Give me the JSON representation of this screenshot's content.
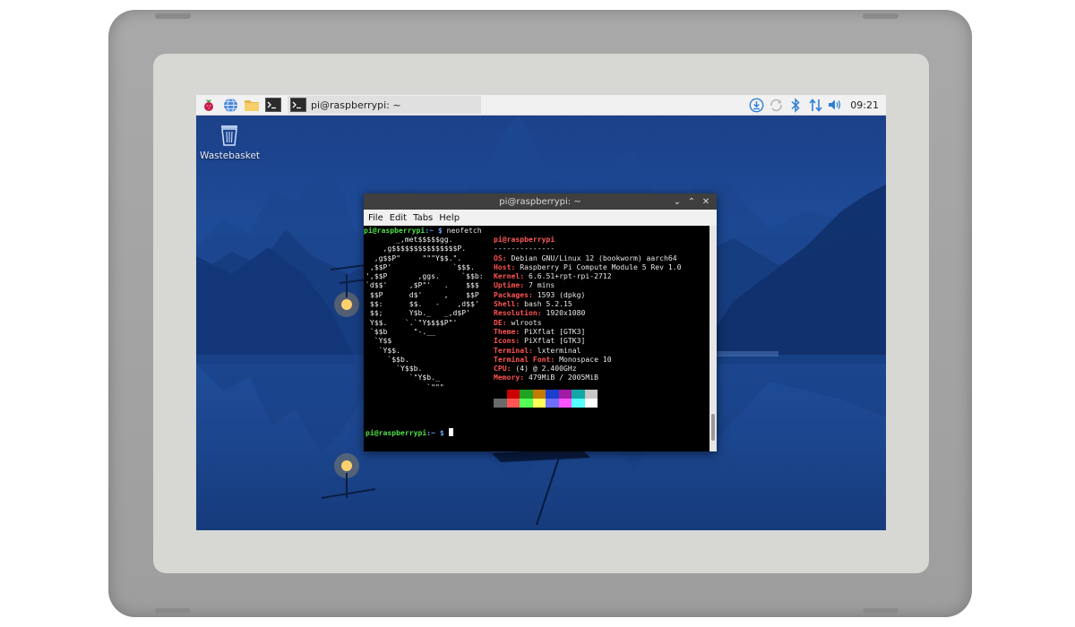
{
  "taskbar": {
    "task_label": "pi@raspberrypi: ~",
    "clock": "09:21",
    "icons": [
      "raspberry-menu-icon",
      "browser-globe-icon",
      "file-manager-icon",
      "terminal-icon"
    ],
    "tray_icons": [
      "updater-icon",
      "sync-icon",
      "bluetooth-icon",
      "network-icon",
      "volume-icon"
    ]
  },
  "desktop": {
    "wastebasket_label": "Wastebasket"
  },
  "terminal": {
    "title": "pi@raspberrypi: ~",
    "controls": [
      "⌄",
      "⌃",
      "✕"
    ],
    "menu": [
      "File",
      "Edit",
      "Tabs",
      "Help"
    ],
    "prompt_user": "pi@raspberrypi",
    "prompt_path": ":~ $",
    "command": " neofetch",
    "logo_lines": [
      "       _,met$$$$$gg.",
      "    ,g$$$$$$$$$$$$$$$P.",
      "  ,g$$P\"     \"\"\"Y$$.\".",
      " ,$$P'              `$$$.",
      "',$$P       ,ggs.     `$$b:",
      "`d$$'     ,$P\"'   .    $$$",
      " $$P      d$'     ,    $$P",
      " $$:      $$.   -    ,d$$'",
      " $$;      Y$b._   _,d$P'",
      " Y$$.    `.`\"Y$$$$P\"'",
      " `$$b      \"-.__",
      "  `Y$$",
      "   `Y$$.",
      "     `$$b.",
      "       `Y$$b.",
      "          `\"Y$b._",
      "              `\"\"\""
    ],
    "info_header": "pi@raspberrypi",
    "info_separator": "--------------",
    "info": [
      {
        "key": "OS",
        "value": "Debian GNU/Linux 12 (bookworm) aarch64"
      },
      {
        "key": "Host",
        "value": "Raspberry Pi Compute Module 5 Rev 1.0"
      },
      {
        "key": "Kernel",
        "value": "6.6.51+rpt-rpi-2712"
      },
      {
        "key": "Uptime",
        "value": "7 mins"
      },
      {
        "key": "Packages",
        "value": "1593 (dpkg)"
      },
      {
        "key": "Shell",
        "value": "bash 5.2.15"
      },
      {
        "key": "Resolution",
        "value": "1920x1080"
      },
      {
        "key": "DE",
        "value": "wlroots"
      },
      {
        "key": "Theme",
        "value": "PiXflat [GTK3]"
      },
      {
        "key": "Icons",
        "value": "PiXflat [GTK3]"
      },
      {
        "key": "Terminal",
        "value": "lxterminal"
      },
      {
        "key": "Terminal Font",
        "value": "Monospace 10"
      },
      {
        "key": "CPU",
        "value": "(4) @ 2.400GHz"
      },
      {
        "key": "Memory",
        "value": "479MiB / 2005MiB"
      }
    ],
    "palette_top": [
      "#000000",
      "#cc0000",
      "#22a222",
      "#c47a00",
      "#1a3fcf",
      "#a31aa3",
      "#12a7a7",
      "#c8c8c8"
    ],
    "palette_bottom": [
      "#6a6a6a",
      "#ff5555",
      "#55ff55",
      "#ffff55",
      "#6e6eff",
      "#ff55ff",
      "#55ffff",
      "#ffffff"
    ]
  },
  "colors": {
    "taskbar_bg": "#f1f1f1",
    "terminal_title_bg": "#3f3f3f",
    "prompt_green": "#4fe04a",
    "prompt_blue": "#6aa6ff",
    "info_key_red": "#ff5353"
  }
}
